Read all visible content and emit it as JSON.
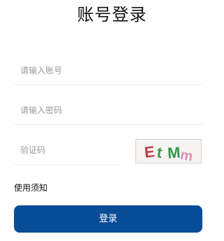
{
  "page": {
    "title": "账号登录"
  },
  "form": {
    "account": {
      "placeholder": "请输入账号",
      "value": ""
    },
    "password": {
      "placeholder": "请输入密码",
      "value": ""
    },
    "captcha": {
      "placeholder": "验证码",
      "value": "",
      "image_text": "EtMm",
      "glyphs": [
        {
          "char": "E",
          "color": "#c23b4a"
        },
        {
          "char": "t",
          "color": "#3a9a45"
        },
        {
          "char": "M",
          "color": "#2f9a4a"
        },
        {
          "char": "m",
          "color": "#d77fa8"
        }
      ]
    }
  },
  "notice_link": "使用须知",
  "login_button": "登录",
  "colors": {
    "primary": "#0a4d97",
    "divider": "#ececec",
    "placeholder": "#9a9a9a"
  }
}
